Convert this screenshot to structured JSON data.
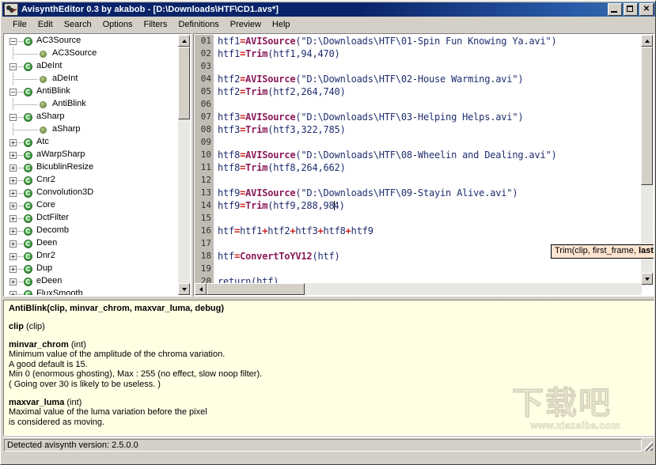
{
  "window": {
    "title": "AvisynthEditor 0.3 by akabob - [D:\\Downloads\\HTF\\CD1.avs*]",
    "icon": "film-reel-icon",
    "minimize_label": "",
    "maximize_label": "",
    "close_label": "✕"
  },
  "menubar": {
    "items": [
      {
        "label": "File"
      },
      {
        "label": "Edit"
      },
      {
        "label": "Search"
      },
      {
        "label": "Options"
      },
      {
        "label": "Filters"
      },
      {
        "label": "Definitions"
      },
      {
        "label": "Preview"
      },
      {
        "label": "Help"
      }
    ]
  },
  "tree": {
    "nodes": [
      {
        "label": "AC3Source",
        "depth": 0,
        "kind": "category",
        "expander": "−"
      },
      {
        "label": "AC3Source",
        "depth": 1,
        "kind": "function",
        "expander": ""
      },
      {
        "label": "aDeInt",
        "depth": 0,
        "kind": "category",
        "expander": "−"
      },
      {
        "label": "aDeInt",
        "depth": 1,
        "kind": "function",
        "expander": ""
      },
      {
        "label": "AntiBlink",
        "depth": 0,
        "kind": "category",
        "expander": "−"
      },
      {
        "label": "AntiBlink",
        "depth": 1,
        "kind": "function",
        "expander": ""
      },
      {
        "label": "aSharp",
        "depth": 0,
        "kind": "category",
        "expander": "−"
      },
      {
        "label": "aSharp",
        "depth": 1,
        "kind": "function",
        "expander": ""
      },
      {
        "label": "Atc",
        "depth": 0,
        "kind": "category",
        "expander": "+"
      },
      {
        "label": "aWarpSharp",
        "depth": 0,
        "kind": "category",
        "expander": "+"
      },
      {
        "label": "BicublinResize",
        "depth": 0,
        "kind": "category",
        "expander": "+"
      },
      {
        "label": "Cnr2",
        "depth": 0,
        "kind": "category",
        "expander": "+"
      },
      {
        "label": "Convolution3D",
        "depth": 0,
        "kind": "category",
        "expander": "+"
      },
      {
        "label": "Core",
        "depth": 0,
        "kind": "category",
        "expander": "+"
      },
      {
        "label": "DctFilter",
        "depth": 0,
        "kind": "category",
        "expander": "+"
      },
      {
        "label": "Decomb",
        "depth": 0,
        "kind": "category",
        "expander": "+"
      },
      {
        "label": "Deen",
        "depth": 0,
        "kind": "category",
        "expander": "+"
      },
      {
        "label": "Dnr2",
        "depth": 0,
        "kind": "category",
        "expander": "+"
      },
      {
        "label": "Dup",
        "depth": 0,
        "kind": "category",
        "expander": "+"
      },
      {
        "label": "eDeen",
        "depth": 0,
        "kind": "category",
        "expander": "+"
      },
      {
        "label": "FluxSmooth",
        "depth": 0,
        "kind": "category",
        "expander": "+"
      }
    ]
  },
  "editor": {
    "line_numbers": [
      "01",
      "02",
      "03",
      "04",
      "05",
      "06",
      "07",
      "08",
      "09",
      "10",
      "11",
      "12",
      "13",
      "14",
      "15",
      "16",
      "17",
      "18",
      "19",
      "20"
    ],
    "lines": [
      {
        "n": "01",
        "segments": [
          {
            "t": "htf1",
            "c": "plain"
          },
          {
            "t": "=",
            "c": "op"
          },
          {
            "t": "AVISource",
            "c": "kw"
          },
          {
            "t": "(\"D:\\Downloads\\HTF\\01-Spin Fun Knowing Ya.avi\")",
            "c": "plain"
          }
        ]
      },
      {
        "n": "02",
        "segments": [
          {
            "t": "htf1",
            "c": "plain"
          },
          {
            "t": "=",
            "c": "op"
          },
          {
            "t": "Trim",
            "c": "kw"
          },
          {
            "t": "(htf1,94,470)",
            "c": "plain"
          }
        ]
      },
      {
        "n": "03",
        "segments": []
      },
      {
        "n": "04",
        "segments": [
          {
            "t": "htf2",
            "c": "plain"
          },
          {
            "t": "=",
            "c": "op"
          },
          {
            "t": "AVISource",
            "c": "kw"
          },
          {
            "t": "(\"D:\\Downloads\\HTF\\02-House Warming.avi\")",
            "c": "plain"
          }
        ]
      },
      {
        "n": "05",
        "segments": [
          {
            "t": "htf2",
            "c": "plain"
          },
          {
            "t": "=",
            "c": "op"
          },
          {
            "t": "Trim",
            "c": "kw"
          },
          {
            "t": "(htf2,264,740)",
            "c": "plain"
          }
        ]
      },
      {
        "n": "06",
        "segments": []
      },
      {
        "n": "07",
        "segments": [
          {
            "t": "htf3",
            "c": "plain"
          },
          {
            "t": "=",
            "c": "op"
          },
          {
            "t": "AVISource",
            "c": "kw"
          },
          {
            "t": "(\"D:\\Downloads\\HTF\\03-Helping Helps.avi\")",
            "c": "plain"
          }
        ]
      },
      {
        "n": "08",
        "segments": [
          {
            "t": "htf3",
            "c": "plain"
          },
          {
            "t": "=",
            "c": "op"
          },
          {
            "t": "Trim",
            "c": "kw"
          },
          {
            "t": "(htf3,322,785)",
            "c": "plain"
          }
        ]
      },
      {
        "n": "09",
        "segments": []
      },
      {
        "n": "10",
        "segments": [
          {
            "t": "htf8",
            "c": "plain"
          },
          {
            "t": "=",
            "c": "op"
          },
          {
            "t": "AVISource",
            "c": "kw"
          },
          {
            "t": "(\"D:\\Downloads\\HTF\\08-Wheelin and Dealing.avi\")",
            "c": "plain"
          }
        ]
      },
      {
        "n": "11",
        "segments": [
          {
            "t": "htf8",
            "c": "plain"
          },
          {
            "t": "=",
            "c": "op"
          },
          {
            "t": "Trim",
            "c": "kw"
          },
          {
            "t": "(htf8,264,662)",
            "c": "plain"
          }
        ]
      },
      {
        "n": "12",
        "segments": []
      },
      {
        "n": "13",
        "segments": [
          {
            "t": "htf9",
            "c": "plain"
          },
          {
            "t": "=",
            "c": "op"
          },
          {
            "t": "AVISource",
            "c": "kw"
          },
          {
            "t": "(\"D:\\Downloads\\HTF\\09-Stayin Alive.avi\")",
            "c": "plain"
          }
        ]
      },
      {
        "n": "14",
        "segments": [
          {
            "t": "htf9",
            "c": "plain"
          },
          {
            "t": "=",
            "c": "op"
          },
          {
            "t": "Trim",
            "c": "kw"
          },
          {
            "t": "(htf9,288,98",
            "c": "plain"
          },
          {
            "t": "",
            "c": "caret"
          },
          {
            "t": "4)",
            "c": "plain"
          }
        ]
      },
      {
        "n": "15",
        "segments": []
      },
      {
        "n": "16",
        "segments": [
          {
            "t": "htf",
            "c": "plain"
          },
          {
            "t": "=",
            "c": "op"
          },
          {
            "t": "htf1",
            "c": "plain"
          },
          {
            "t": "+",
            "c": "op"
          },
          {
            "t": "htf2",
            "c": "plain"
          },
          {
            "t": "+",
            "c": "op"
          },
          {
            "t": "htf3",
            "c": "plain"
          },
          {
            "t": "+",
            "c": "op"
          },
          {
            "t": "htf8",
            "c": "plain"
          },
          {
            "t": "+",
            "c": "op"
          },
          {
            "t": "htf9",
            "c": "plain"
          }
        ]
      },
      {
        "n": "17",
        "segments": []
      },
      {
        "n": "18",
        "segments": [
          {
            "t": "htf",
            "c": "plain"
          },
          {
            "t": "=",
            "c": "op"
          },
          {
            "t": "ConvertToYV12",
            "c": "kw"
          },
          {
            "t": "(htf)",
            "c": "plain"
          }
        ]
      },
      {
        "n": "19",
        "segments": []
      },
      {
        "n": "20",
        "segments": [
          {
            "t": "return(htf)",
            "c": "plain"
          }
        ]
      }
    ]
  },
  "tooltip": {
    "prefix": "Trim(clip, first_frame, ",
    "highlight": "last_frame",
    "suffix": ")"
  },
  "doc": {
    "signature": "AntiBlink(clip, minvar_chrom, maxvar_luma, debug)",
    "blocks": [
      {
        "name": "clip",
        "type": " (clip)",
        "lines": []
      },
      {
        "name": "minvar_chrom",
        "type": " (int)",
        "lines": [
          "Minimum value of the amplitude of the chroma variation.",
          "A good default is 15.",
          "Min 0 (enormous ghosting), Max : 255 (no effect, slow noop filter).",
          "( Going over 30 is likely to be useless. )"
        ]
      },
      {
        "name": "maxvar_luma",
        "type": " (int)",
        "lines": [
          "Maximal value of the luma variation before the pixel",
          "is considered as moving."
        ]
      }
    ]
  },
  "statusbar": {
    "text": "Detected avisynth version: 2.5.0.0"
  },
  "watermark": {
    "cn": "下载吧",
    "url": "www.xiazaiba.com"
  },
  "colors": {
    "title_bar": "#0a246a",
    "face": "#d4d0c8",
    "code_text": "#1f2d6e",
    "keyword": "#8b1a5a",
    "operator": "#cc2222",
    "doc_bg": "#ffffe4",
    "tooltip_bg": "#ffe4d0",
    "tree_icon_green": "#3f9e3f"
  }
}
